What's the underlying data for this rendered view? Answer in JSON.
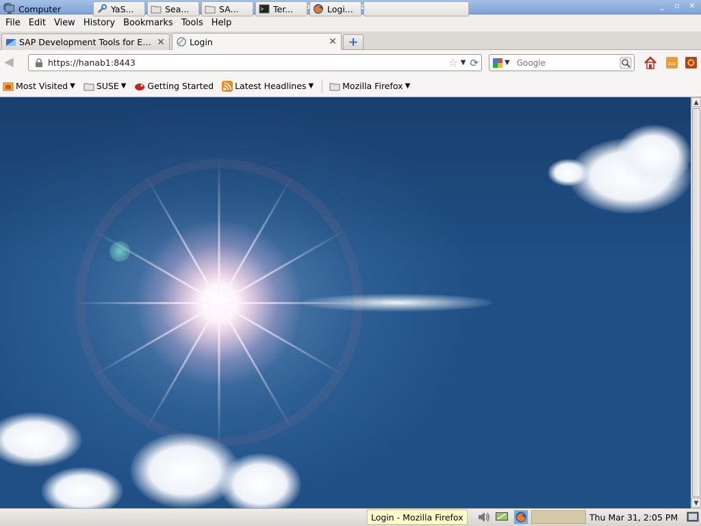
{
  "window": {
    "title": "Login - Mozilla Firefox"
  },
  "menubar": {
    "items": [
      "File",
      "Edit",
      "View",
      "History",
      "Bookmarks",
      "Tools",
      "Help"
    ]
  },
  "tabs": [
    {
      "label": "SAP Development Tools for Ecli...",
      "icon": "sap-icon",
      "active": false
    },
    {
      "label": "Login",
      "icon": "globe-icon",
      "active": true
    }
  ],
  "navbar": {
    "url": "https://hanab1:8443",
    "search_placeholder": "Google"
  },
  "bookmarks": [
    {
      "label": "Most Visited",
      "icon": "most-visited-icon",
      "dropdown": true
    },
    {
      "label": "SUSE",
      "icon": "folder-icon",
      "dropdown": true
    },
    {
      "label": "Getting Started",
      "icon": "suse-chameleon-icon",
      "dropdown": false
    },
    {
      "label": "Latest Headlines",
      "icon": "rss-icon",
      "dropdown": true
    },
    {
      "label": "Mozilla Firefox",
      "icon": "folder-icon",
      "dropdown": true
    }
  ],
  "taskbar": {
    "computer_label": "Computer",
    "items": [
      {
        "label": "YaS...",
        "icon": "yast-icon"
      },
      {
        "label": "Sea...",
        "icon": "folder-icon"
      },
      {
        "label": "SA...",
        "icon": "folder-icon"
      },
      {
        "label": "Ter...",
        "icon": "terminal-icon"
      },
      {
        "label": "Logi...",
        "icon": "firefox-icon"
      },
      {
        "label": "Login - Mozilla Firefox",
        "icon": "tooltip"
      }
    ],
    "tooltip": "Login - Mozilla Firefox",
    "clock": "Thu Mar 31,  2:05 PM"
  },
  "colors": {
    "titlebar": "#7fa4d6",
    "sky": "#245588",
    "tooltip_bg": "#ffffcc"
  }
}
